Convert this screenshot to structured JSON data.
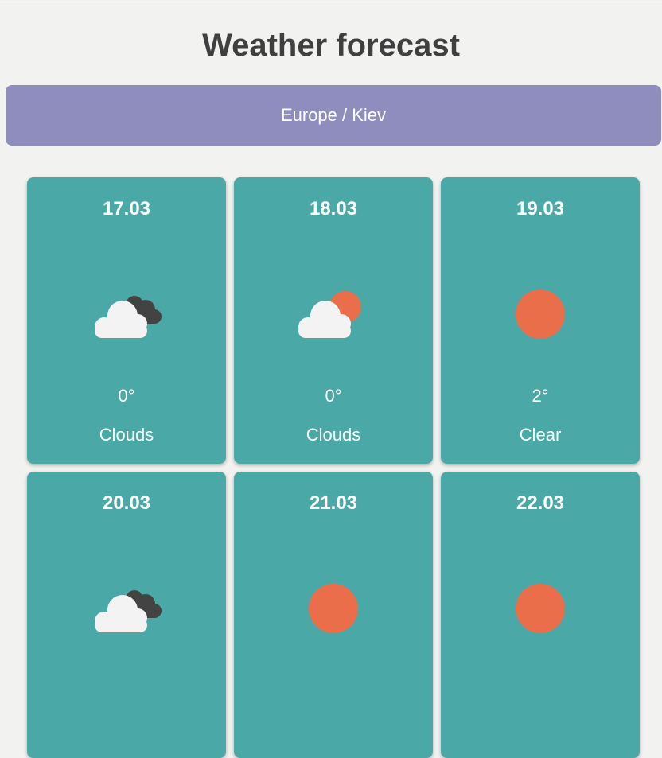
{
  "page": {
    "title": "Weather forecast",
    "location": "Europe / Kiev"
  },
  "colors": {
    "location_bar": "#8f8cbe",
    "card": "#4aa9a6",
    "sun": "#eb6e4b",
    "cloud_light": "#f3f3f3",
    "cloud_dark": "#434343",
    "background": "#f2f2f1"
  },
  "forecast": [
    {
      "date": "17.03",
      "temp": "0°",
      "desc": "Clouds",
      "icon": "clouds-icon"
    },
    {
      "date": "18.03",
      "temp": "0°",
      "desc": "Clouds",
      "icon": "cloud-sun-icon"
    },
    {
      "date": "19.03",
      "temp": "2°",
      "desc": "Clear",
      "icon": "sun-icon"
    },
    {
      "date": "20.03",
      "temp": "",
      "desc": "",
      "icon": "clouds-icon"
    },
    {
      "date": "21.03",
      "temp": "",
      "desc": "",
      "icon": "sun-icon"
    },
    {
      "date": "22.03",
      "temp": "",
      "desc": "",
      "icon": "sun-icon"
    }
  ]
}
